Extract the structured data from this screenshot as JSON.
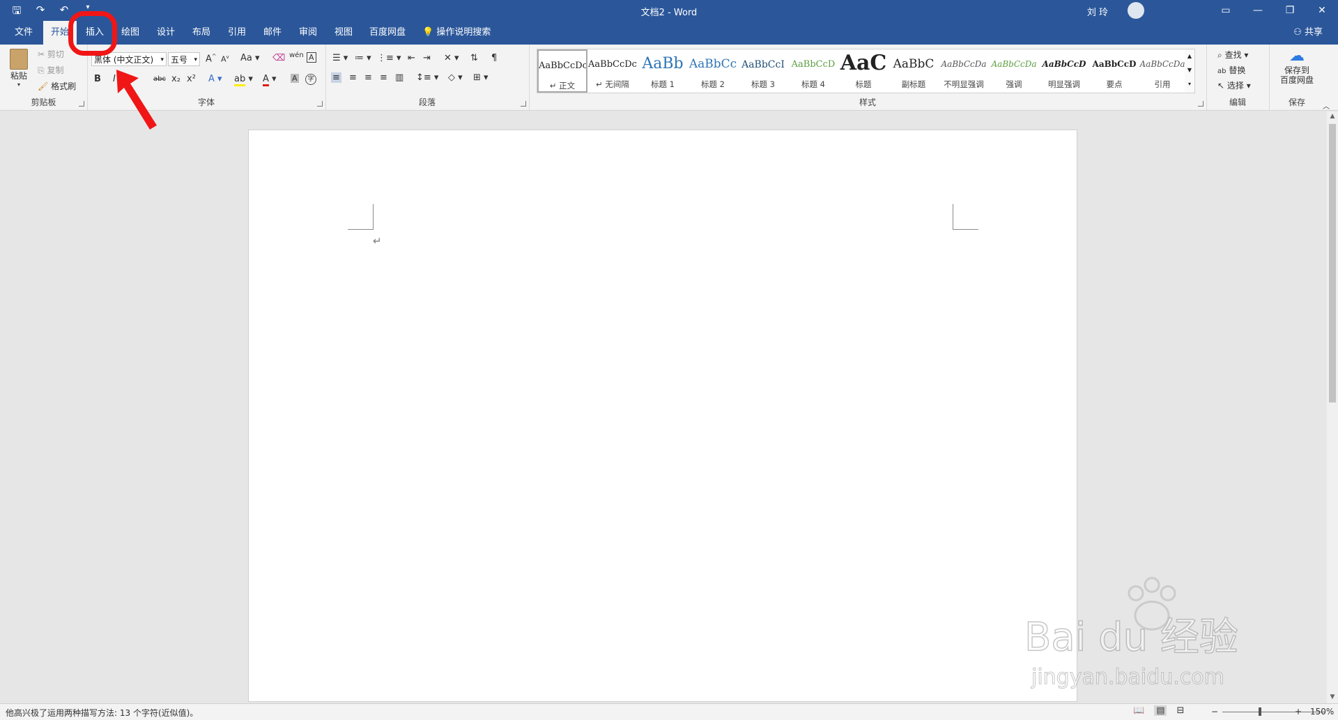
{
  "titlebar": {
    "doc_title": "文档2  -  Word",
    "user_name": "刘 玲",
    "qat_icons": [
      "save-icon",
      "redo-icon",
      "undo-icon",
      "customize-icon"
    ],
    "window_controls": [
      "ribbon-display-icon",
      "minimize-icon",
      "restore-icon",
      "close-icon"
    ]
  },
  "tabs": [
    "文件",
    "开始",
    "插入",
    "绘图",
    "设计",
    "布局",
    "引用",
    "邮件",
    "审阅",
    "视图",
    "百度网盘"
  ],
  "active_tab": "开始",
  "tell_me": "操作说明搜索",
  "share": "共享",
  "clipboard": {
    "paste": "粘贴",
    "cut": "剪切",
    "copy": "复制",
    "format_painter": "格式刷",
    "label": "剪贴板"
  },
  "font": {
    "name": "黑体 (中文正文)",
    "size": "五号",
    "label": "字体",
    "aa": "Aa",
    "wen": "wén",
    "bold": "B",
    "italic": "I",
    "abc": "abc",
    "sub": "x₂",
    "sup": "x²",
    "a_glyph": "A",
    "a_bigger": "A",
    "a_smaller": "A",
    "a_border": "A",
    "wen_circle": "字"
  },
  "paragraph": {
    "label": "段落"
  },
  "styles": {
    "label": "样式",
    "items": [
      {
        "preview": "AaBbCcDc",
        "name": "正文"
      },
      {
        "preview": "AaBbCcDc",
        "name": "无间隔"
      },
      {
        "preview": "AaBb",
        "name": "标题 1"
      },
      {
        "preview": "AaBbCc",
        "name": "标题 2"
      },
      {
        "preview": "AaBbCcI",
        "name": "标题 3"
      },
      {
        "preview": "AaBbCcD",
        "name": "标题 4"
      },
      {
        "preview": "AaC",
        "name": "标题"
      },
      {
        "preview": "AaBbC",
        "name": "副标题"
      },
      {
        "preview": "AaBbCcDa",
        "name": "不明显强调"
      },
      {
        "preview": "AaBbCcDa",
        "name": "强调"
      },
      {
        "preview": "AaBbCcD",
        "name": "明显强调"
      },
      {
        "preview": "AaBbCcD",
        "name": "要点"
      },
      {
        "preview": "AaBbCcDa",
        "name": "引用"
      }
    ]
  },
  "editing": {
    "find": "查找",
    "replace": "替换",
    "select": "选择",
    "label": "编辑"
  },
  "save": {
    "line1": "保存到",
    "line2": "百度网盘",
    "label": "保存"
  },
  "document": {
    "paragraph_mark": "↵"
  },
  "statusbar": {
    "text": "他高兴极了运用两种描写方法: 13 个字符(近似值)。",
    "zoom": "150%",
    "zoom_minus": "−",
    "zoom_plus": "+"
  },
  "watermark": {
    "brand": "Bai du 经验",
    "url": "jingyan.baidu.com"
  },
  "colors": {
    "ribbon_blue": "#2b579a",
    "annotation_red": "#f01616"
  }
}
